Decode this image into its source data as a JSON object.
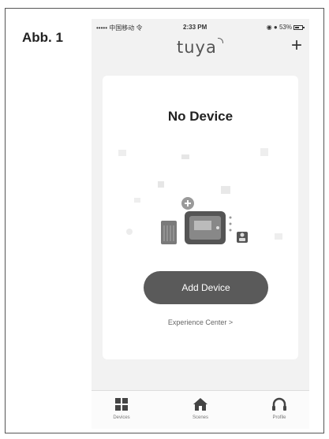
{
  "figure": {
    "label": "Abb. 1"
  },
  "status_bar": {
    "carrier": "••••• 中国移动 令",
    "time": "2:33 PM",
    "battery": "◉ ● 53%"
  },
  "header": {
    "logo": "tuya",
    "add_icon": "plus-icon",
    "add_label": "+"
  },
  "main": {
    "title": "No Device",
    "add_button": "Add Device",
    "experience_link": "Experience Center >"
  },
  "tabs": [
    {
      "label": "Devices",
      "icon": "grid-icon"
    },
    {
      "label": "Scenes",
      "icon": "home-icon"
    },
    {
      "label": "Profile",
      "icon": "headphones-icon"
    }
  ],
  "colors": {
    "button": "#5a5a5a",
    "background": "#f2f2f2",
    "card": "#ffffff"
  }
}
